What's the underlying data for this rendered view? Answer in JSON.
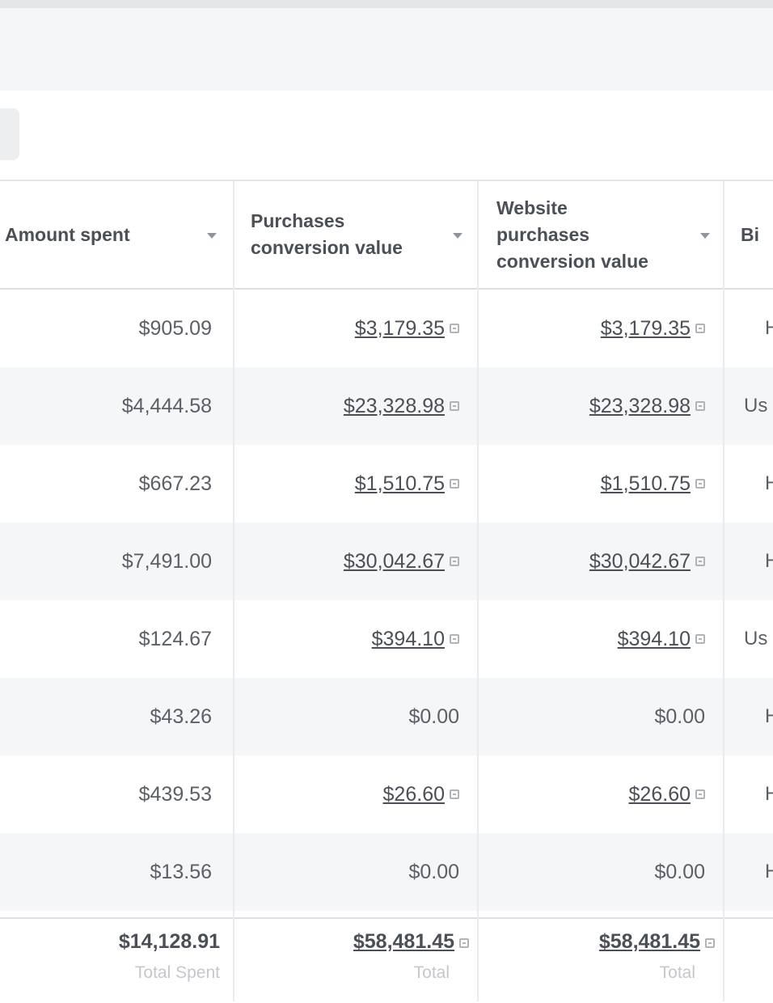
{
  "columns": {
    "amount_spent": "Amount spent",
    "purchases_value": "Purchases\nconversion value",
    "website_purchases_value": "Website\npurchases\nconversion value",
    "bid_partial": "Bi"
  },
  "rows": [
    {
      "spent": "$905.09",
      "purchases": "$3,179.35",
      "website": "$3,179.35",
      "bid": "H"
    },
    {
      "spent": "$4,444.58",
      "purchases": "$23,328.98",
      "website": "$23,328.98",
      "bid": "Us"
    },
    {
      "spent": "$667.23",
      "purchases": "$1,510.75",
      "website": "$1,510.75",
      "bid": "H"
    },
    {
      "spent": "$7,491.00",
      "purchases": "$30,042.67",
      "website": "$30,042.67",
      "bid": "H"
    },
    {
      "spent": "$124.67",
      "purchases": "$394.10",
      "website": "$394.10",
      "bid": "Us"
    },
    {
      "spent": "$43.26",
      "purchases": "$0.00",
      "website": "$0.00",
      "bid": "H"
    },
    {
      "spent": "$439.53",
      "purchases": "$26.60",
      "website": "$26.60",
      "bid": "H"
    },
    {
      "spent": "$13.56",
      "purchases": "$0.00",
      "website": "$0.00",
      "bid": "H"
    }
  ],
  "totals": {
    "spent": "$14,128.91",
    "spent_label": "Total Spent",
    "purchases": "$58,481.45",
    "purchases_label": "Total",
    "website": "$58,481.45",
    "website_label": "Total"
  }
}
